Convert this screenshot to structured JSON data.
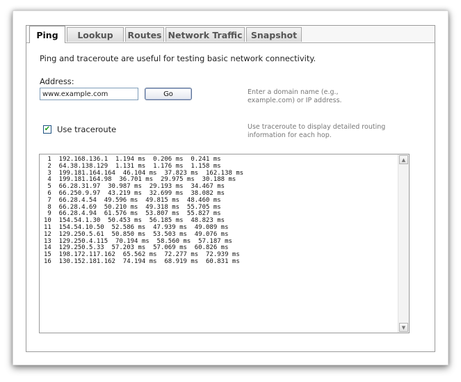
{
  "tabs": [
    {
      "label": "Ping",
      "active": true
    },
    {
      "label": "Lookup",
      "active": false
    },
    {
      "label": "Routes",
      "active": false
    },
    {
      "label": "Network Traffic",
      "active": false
    },
    {
      "label": "Snapshot",
      "active": false
    }
  ],
  "description": "Ping and traceroute are useful for testing basic network connectivity.",
  "address": {
    "label": "Address:",
    "value": "www.example.com",
    "hint": "Enter a domain name (e.g., example.com) or IP address."
  },
  "go_label": "Go",
  "traceroute": {
    "label": "Use traceroute",
    "checked": true,
    "hint": "Use traceroute to display detailed routing information for each hop."
  },
  "output_lines": [
    " 1  192.168.136.1  1.194 ms  0.206 ms  0.241 ms",
    " 2  64.38.138.129  1.131 ms  1.176 ms  1.158 ms",
    " 3  199.181.164.164  46.104 ms  37.823 ms  162.138 ms",
    " 4  199.181.164.98  36.701 ms  29.975 ms  30.188 ms",
    " 5  66.28.31.97  30.987 ms  29.193 ms  34.467 ms",
    " 6  66.250.9.97  43.219 ms  32.699 ms  38.082 ms",
    " 7  66.28.4.54  49.596 ms  49.815 ms  48.460 ms",
    " 8  66.28.4.69  50.210 ms  49.318 ms  55.705 ms",
    " 9  66.28.4.94  61.576 ms  53.807 ms  55.827 ms",
    "10  154.54.1.30  50.453 ms  56.185 ms  48.823 ms",
    "11  154.54.10.50  52.586 ms  47.939 ms  49.089 ms",
    "12  129.250.5.61  50.850 ms  53.503 ms  49.076 ms",
    "13  129.250.4.115  70.194 ms  58.560 ms  57.187 ms",
    "14  129.250.5.33  57.203 ms  57.069 ms  60.826 ms",
    "15  198.172.117.162  65.562 ms  72.277 ms  72.939 ms",
    "16  130.152.181.162  74.194 ms  68.919 ms  60.831 ms"
  ],
  "icons": {
    "checkbox": "checkmark-icon",
    "scroll_up": "arrow-up-icon",
    "scroll_down": "arrow-down-icon"
  }
}
